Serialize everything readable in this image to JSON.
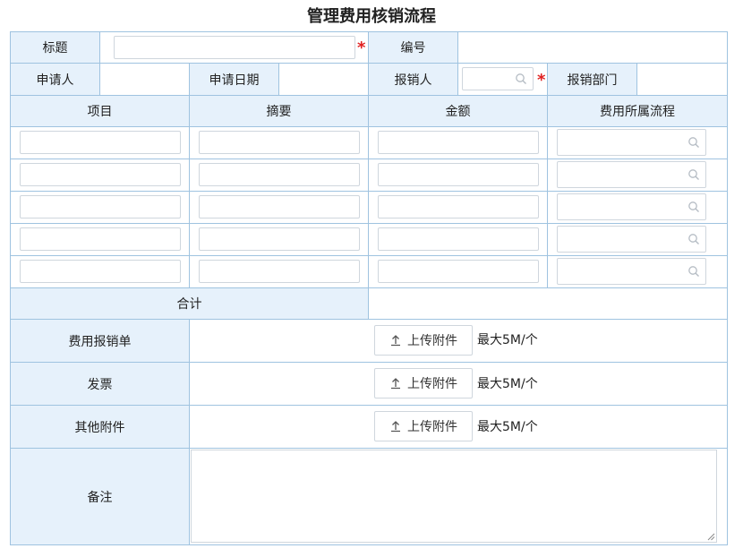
{
  "page": {
    "title": "管理费用核销流程"
  },
  "header": {
    "title_label": "标题",
    "number_label": "编号",
    "applicant_label": "申请人",
    "apply_date_label": "申请日期",
    "reimburser_label": "报销人",
    "department_label": "报销部门",
    "required_mark": "*"
  },
  "detail": {
    "columns": [
      "项目",
      "摘要",
      "金额",
      "费用所属流程"
    ],
    "row_count": 5,
    "total_label": "合计"
  },
  "attachments": {
    "upload_label": "上传附件",
    "size_note": "最大5M/个",
    "rows": [
      "费用报销单",
      "发票",
      "其他附件"
    ]
  },
  "remarks": {
    "label": "备注"
  },
  "icons": {
    "search": "search-icon",
    "upload": "upload-icon",
    "resize": "resize-grip-icon"
  },
  "colors": {
    "label_bg": "#e6f1fb",
    "border": "#9fc3e0",
    "required": "#e02020"
  }
}
